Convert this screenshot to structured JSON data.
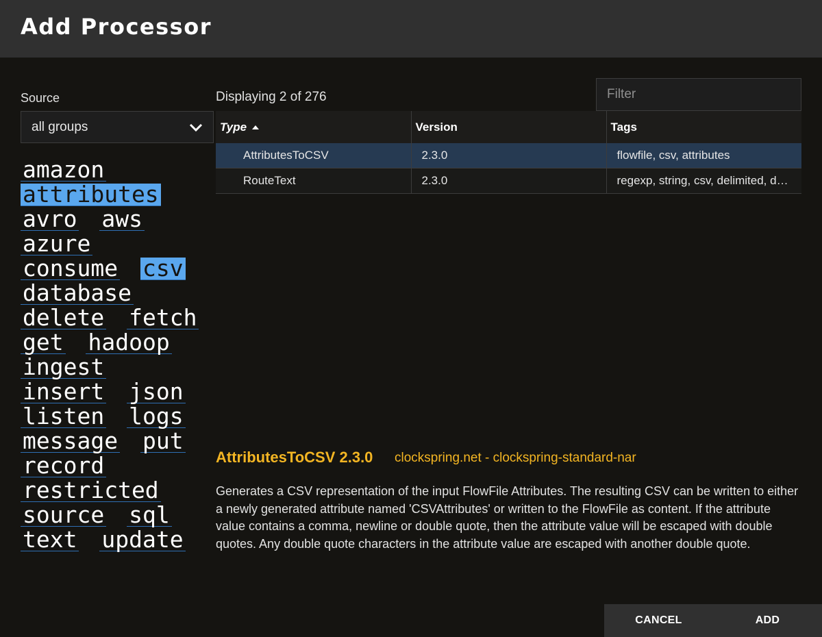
{
  "dialog": {
    "title": "Add Processor"
  },
  "source": {
    "label": "Source",
    "selected": "all groups"
  },
  "tags": [
    {
      "label": "amazon",
      "selected": false
    },
    {
      "label": "attributes",
      "selected": true
    },
    {
      "label": "avro",
      "selected": false
    },
    {
      "label": "aws",
      "selected": false
    },
    {
      "label": "azure",
      "selected": false
    },
    {
      "label": "consume",
      "selected": false
    },
    {
      "label": "csv",
      "selected": true
    },
    {
      "label": "database",
      "selected": false
    },
    {
      "label": "delete",
      "selected": false
    },
    {
      "label": "fetch",
      "selected": false
    },
    {
      "label": "get",
      "selected": false
    },
    {
      "label": "hadoop",
      "selected": false
    },
    {
      "label": "ingest",
      "selected": false
    },
    {
      "label": "insert",
      "selected": false
    },
    {
      "label": "json",
      "selected": false
    },
    {
      "label": "listen",
      "selected": false
    },
    {
      "label": "logs",
      "selected": false
    },
    {
      "label": "message",
      "selected": false
    },
    {
      "label": "put",
      "selected": false
    },
    {
      "label": "record",
      "selected": false
    },
    {
      "label": "restricted",
      "selected": false
    },
    {
      "label": "source",
      "selected": false
    },
    {
      "label": "sql",
      "selected": false
    },
    {
      "label": "text",
      "selected": false
    },
    {
      "label": "update",
      "selected": false
    }
  ],
  "results": {
    "displaying": "Displaying 2 of 276"
  },
  "filter": {
    "placeholder": "Filter",
    "value": ""
  },
  "table": {
    "columns": [
      "Type",
      "Version",
      "Tags"
    ],
    "rows": [
      {
        "type": "AttributesToCSV",
        "version": "2.3.0",
        "tags": "flowfile, csv, attributes",
        "selected": true
      },
      {
        "type": "RouteText",
        "version": "2.3.0",
        "tags": "regexp, string, csv, delimited, delimiter, text, update",
        "selected": false
      }
    ]
  },
  "detail": {
    "title": "AttributesToCSV 2.3.0",
    "bundle": "clockspring.net - clockspring-standard-nar",
    "description": "Generates a CSV representation of the input FlowFile Attributes. The resulting CSV can be written to either a newly generated attribute named 'CSVAttributes' or written to the FlowFile as content. If the attribute value contains a comma, newline or double quote, then the attribute value will be escaped with double quotes. Any double quote characters in the attribute value are escaped with another double quote."
  },
  "actions": {
    "cancel": "CANCEL",
    "add": "ADD"
  },
  "colors": {
    "accent": "#f3b523",
    "tag_selected": "#5aa7ee",
    "row_selected": "#263a52",
    "header_bg": "#303030",
    "background": "#151411"
  }
}
